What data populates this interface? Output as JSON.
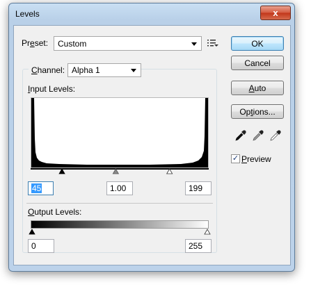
{
  "window": {
    "title": "Levels",
    "close_glyph": "x"
  },
  "preset": {
    "label_pre": "Pr",
    "label_key": "e",
    "label_post": "set:",
    "value": "Custom"
  },
  "channel": {
    "label_key": "C",
    "label_post": "hannel:",
    "value": "Alpha 1"
  },
  "input_levels": {
    "label_key": "I",
    "label_post": "nput Levels:",
    "black": "45",
    "gamma": "1.00",
    "white": "199",
    "black_fraction": 0.176,
    "gamma_fraction": 0.478,
    "white_fraction": 0.78
  },
  "output_levels": {
    "label_key": "O",
    "label_post": "utput Levels:",
    "black": "0",
    "white": "255"
  },
  "buttons": {
    "ok": "OK",
    "cancel": "Cancel",
    "auto_key": "A",
    "auto_post": "uto",
    "options_pre": "Op",
    "options_key": "t",
    "options_post": "ions..."
  },
  "preview": {
    "label_key": "P",
    "label_post": "review",
    "checked": true,
    "check_glyph": "✓"
  },
  "colors": {
    "accent": "#3399ff",
    "default_button_border": "#3c7fb1",
    "close_button": "#c2371b"
  }
}
